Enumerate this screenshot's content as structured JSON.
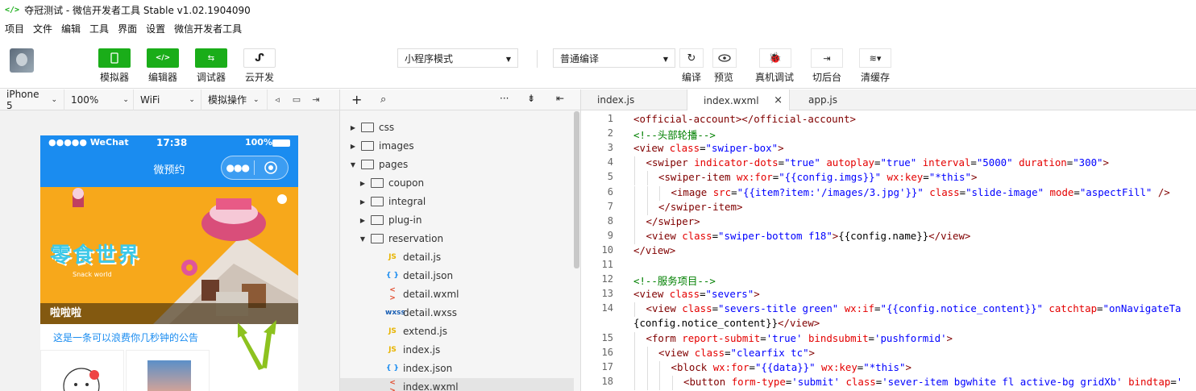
{
  "window": {
    "title": "夺冠测试 - 微信开发者工具 Stable v1.02.1904090"
  },
  "menu": [
    "项目",
    "文件",
    "编辑",
    "工具",
    "界面",
    "设置",
    "微信开发者工具"
  ],
  "toolbar": {
    "simulator": "模拟器",
    "editor": "编辑器",
    "debugger": "调试器",
    "cloud": "云开发",
    "mode": "小程序模式",
    "compile": "普通编译",
    "compile_btn": "编译",
    "preview": "预览",
    "realdebug": "真机调试",
    "backend": "切后台",
    "clearcache": "清缓存"
  },
  "simbar": {
    "device": "iPhone 5",
    "zoom": "100%",
    "network": "WiFi",
    "simop": "模拟操作"
  },
  "phone": {
    "carrier": "●●●●● WeChat",
    "time": "17:38",
    "battery": "100%",
    "nav_title": "微预约",
    "banner_title": "零食世界",
    "banner_sub": "Snack world",
    "caption": "啦啦啦",
    "notice": "这是一条可以浪费你几秒钟的公告"
  },
  "tree": [
    {
      "name": "css",
      "type": "folder",
      "level": 0,
      "open": false
    },
    {
      "name": "images",
      "type": "folder",
      "level": 0,
      "open": false
    },
    {
      "name": "pages",
      "type": "folder",
      "level": 0,
      "open": true
    },
    {
      "name": "coupon",
      "type": "folder",
      "level": 1,
      "open": false
    },
    {
      "name": "integral",
      "type": "folder",
      "level": 1,
      "open": false
    },
    {
      "name": "plug-in",
      "type": "folder",
      "level": 1,
      "open": false
    },
    {
      "name": "reservation",
      "type": "folder",
      "level": 1,
      "open": true
    },
    {
      "name": "detail.js",
      "type": "js",
      "level": 2
    },
    {
      "name": "detail.json",
      "type": "json",
      "level": 2
    },
    {
      "name": "detail.wxml",
      "type": "wxml",
      "level": 2
    },
    {
      "name": "detail.wxss",
      "type": "wxss",
      "level": 2
    },
    {
      "name": "extend.js",
      "type": "js",
      "level": 2
    },
    {
      "name": "index.js",
      "type": "js",
      "level": 2
    },
    {
      "name": "index.json",
      "type": "json",
      "level": 2
    },
    {
      "name": "index.wxml",
      "type": "wxml",
      "level": 2,
      "selected": true
    }
  ],
  "filetype_labels": {
    "js": "JS",
    "json": "{ }",
    "wxml": "< >",
    "wxss": "wxss"
  },
  "tabs": [
    "index.js",
    "index.wxml",
    "app.js"
  ],
  "active_tab": "index.wxml",
  "code": [
    {
      "n": "1",
      "i": 0,
      "parts": [
        [
          "tag",
          "<official-account>"
        ],
        [
          "tag",
          "</official-account>"
        ]
      ]
    },
    {
      "n": "2",
      "i": 0,
      "parts": [
        [
          "cm",
          "<!--头部轮播-->"
        ]
      ]
    },
    {
      "n": "3",
      "i": 0,
      "parts": [
        [
          "tag",
          "<view "
        ],
        [
          "attr",
          "class"
        ],
        [
          "txt",
          "="
        ],
        [
          "val",
          "\"swiper-box\""
        ],
        [
          "tag",
          ">"
        ]
      ]
    },
    {
      "n": "4",
      "i": 1,
      "parts": [
        [
          "tag",
          "<swiper "
        ],
        [
          "attr",
          "indicator-dots"
        ],
        [
          "txt",
          "="
        ],
        [
          "val",
          "\"true\""
        ],
        [
          "attr",
          " autoplay"
        ],
        [
          "txt",
          "="
        ],
        [
          "val",
          "\"true\""
        ],
        [
          "attr",
          " interval"
        ],
        [
          "txt",
          "="
        ],
        [
          "val",
          "\"5000\""
        ],
        [
          "attr",
          " duration"
        ],
        [
          "txt",
          "="
        ],
        [
          "val",
          "\"300\""
        ],
        [
          "tag",
          ">"
        ]
      ]
    },
    {
      "n": "5",
      "i": 2,
      "parts": [
        [
          "tag",
          "<swiper-item "
        ],
        [
          "attr",
          "wx:for"
        ],
        [
          "txt",
          "="
        ],
        [
          "val",
          "\"{{config.imgs}}\""
        ],
        [
          "attr",
          " wx:key"
        ],
        [
          "txt",
          "="
        ],
        [
          "val",
          "\"*this\""
        ],
        [
          "tag",
          ">"
        ]
      ]
    },
    {
      "n": "6",
      "i": 3,
      "parts": [
        [
          "tag",
          "<image "
        ],
        [
          "attr",
          "src"
        ],
        [
          "txt",
          "="
        ],
        [
          "val",
          "\"{{item?item:'/images/3.jpg'}}\""
        ],
        [
          "attr",
          " class"
        ],
        [
          "txt",
          "="
        ],
        [
          "val",
          "\"slide-image\""
        ],
        [
          "attr",
          " mode"
        ],
        [
          "txt",
          "="
        ],
        [
          "val",
          "\"aspectFill\""
        ],
        [
          "tag",
          " />"
        ]
      ]
    },
    {
      "n": "7",
      "i": 2,
      "parts": [
        [
          "tag",
          "</swiper-item>"
        ]
      ]
    },
    {
      "n": "8",
      "i": 1,
      "parts": [
        [
          "tag",
          "</swiper>"
        ]
      ]
    },
    {
      "n": "9",
      "i": 1,
      "parts": [
        [
          "tag",
          "<view "
        ],
        [
          "attr",
          "class"
        ],
        [
          "txt",
          "="
        ],
        [
          "val",
          "\"swiper-bottom f18\""
        ],
        [
          "tag",
          ">"
        ],
        [
          "txt",
          "{{config.name}}"
        ],
        [
          "tag",
          "</view>"
        ]
      ]
    },
    {
      "n": "10",
      "i": 0,
      "parts": [
        [
          "tag",
          "</view>"
        ]
      ]
    },
    {
      "n": "11",
      "i": 0,
      "parts": []
    },
    {
      "n": "12",
      "i": 0,
      "parts": [
        [
          "cm",
          "<!--服务项目-->"
        ]
      ]
    },
    {
      "n": "13",
      "i": 0,
      "parts": [
        [
          "tag",
          "<view "
        ],
        [
          "attr",
          "class"
        ],
        [
          "txt",
          "="
        ],
        [
          "val",
          "\"severs\""
        ],
        [
          "tag",
          ">"
        ]
      ]
    },
    {
      "n": "14",
      "i": 1,
      "parts": [
        [
          "tag",
          "<view "
        ],
        [
          "attr",
          "class"
        ],
        [
          "txt",
          "="
        ],
        [
          "val",
          "\"severs-title green\""
        ],
        [
          "attr",
          " wx:if"
        ],
        [
          "txt",
          "="
        ],
        [
          "val",
          "\"{{config.notice_content}}\""
        ],
        [
          "attr",
          " catchtap"
        ],
        [
          "txt",
          "="
        ],
        [
          "val",
          "\"onNavigateTa"
        ]
      ]
    },
    {
      "n": "",
      "i": 0,
      "parts": [
        [
          "txt",
          "{config.notice_content}}"
        ],
        [
          "tag",
          "</view>"
        ]
      ]
    },
    {
      "n": "15",
      "i": 1,
      "parts": [
        [
          "tag",
          "<form "
        ],
        [
          "attr",
          "report-submit"
        ],
        [
          "txt",
          "="
        ],
        [
          "val",
          "'true'"
        ],
        [
          "attr",
          " bindsubmit"
        ],
        [
          "txt",
          "="
        ],
        [
          "val",
          "'pushformid'"
        ],
        [
          "tag",
          ">"
        ]
      ]
    },
    {
      "n": "16",
      "i": 2,
      "parts": [
        [
          "tag",
          "<view "
        ],
        [
          "attr",
          "class"
        ],
        [
          "txt",
          "="
        ],
        [
          "val",
          "\"clearfix tc\""
        ],
        [
          "tag",
          ">"
        ]
      ]
    },
    {
      "n": "17",
      "i": 3,
      "parts": [
        [
          "tag",
          "<block "
        ],
        [
          "attr",
          "wx:for"
        ],
        [
          "txt",
          "="
        ],
        [
          "val",
          "\"{{data}}\""
        ],
        [
          "attr",
          " wx:key"
        ],
        [
          "txt",
          "="
        ],
        [
          "val",
          "\"*this\""
        ],
        [
          "tag",
          ">"
        ]
      ]
    },
    {
      "n": "18",
      "i": 4,
      "parts": [
        [
          "tag",
          "<button "
        ],
        [
          "attr",
          "form-type"
        ],
        [
          "txt",
          "="
        ],
        [
          "val",
          "'submit'"
        ],
        [
          "attr",
          " class"
        ],
        [
          "txt",
          "="
        ],
        [
          "val",
          "'sever-item bgwhite fl active-bg gridXb'"
        ],
        [
          "attr",
          " bindtap"
        ],
        [
          "txt",
          "="
        ],
        [
          "val",
          "'"
        ]
      ]
    }
  ],
  "colors": {
    "green": "#1aad19",
    "wechat_blue": "#1a8cf0",
    "arrow": "#8dc21f"
  }
}
